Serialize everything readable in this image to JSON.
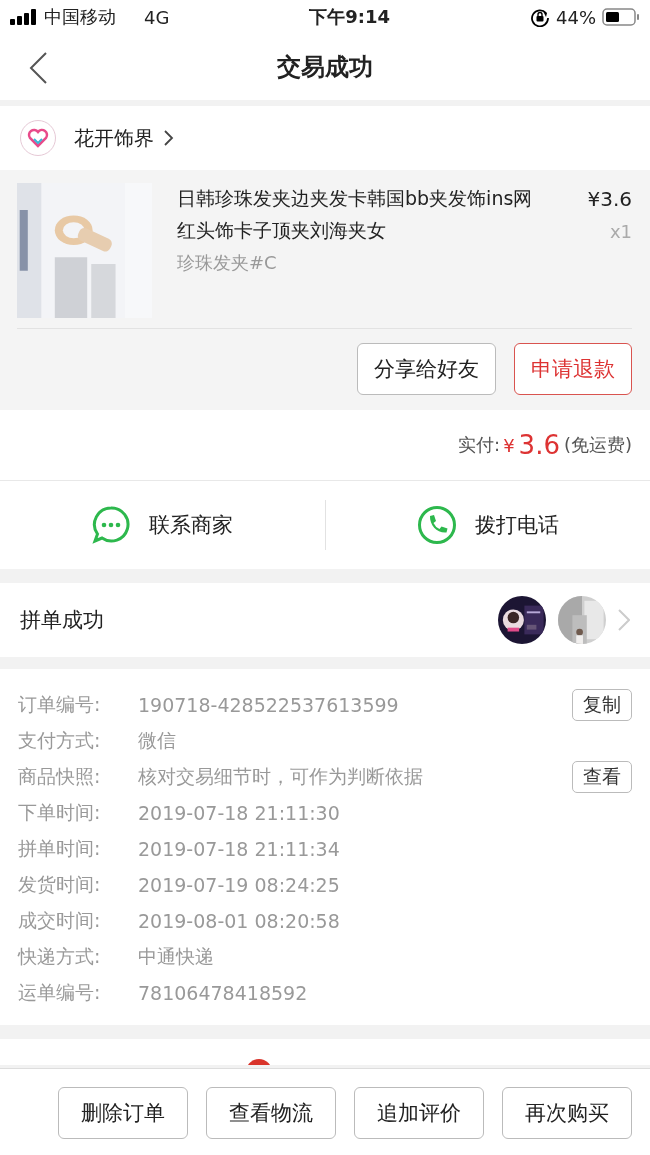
{
  "status_bar": {
    "carrier": "中国移动",
    "network": "4G",
    "time": "下午9:14",
    "battery": "44%"
  },
  "nav": {
    "title": "交易成功"
  },
  "shop": {
    "name": "花开饰界"
  },
  "product": {
    "title": "日韩珍珠发夹边夹发卡韩国bb夹发饰ins网红头饰卡子顶夹刘海夹女",
    "variant": "珍珠发夹#C",
    "price": "¥3.6",
    "quantity": "x1"
  },
  "product_actions": [
    {
      "label": "分享给好友",
      "kind": "plain"
    },
    {
      "label": "申请退款",
      "kind": "danger"
    }
  ],
  "payment": {
    "label": "实付:",
    "currency": "¥",
    "amount": "3.6",
    "note": "(免运费)"
  },
  "contact": [
    {
      "label": "联系商家",
      "kind": "chat"
    },
    {
      "label": "拨打电话",
      "kind": "phone"
    }
  ],
  "group_buy": {
    "title": "拼单成功"
  },
  "order_info": [
    {
      "label": "订单编号:",
      "value": "190718-428522537613599",
      "action": "复制"
    },
    {
      "label": "支付方式:",
      "value": "微信"
    },
    {
      "label": "商品快照:",
      "value": "核对交易细节时，可作为判断依据",
      "action": "查看"
    },
    {
      "label": "下单时间:",
      "value": "2019-07-18 21:11:30"
    },
    {
      "label": "拼单时间:",
      "value": "2019-07-18 21:11:34"
    },
    {
      "label": "发货时间:",
      "value": "2019-07-19 08:24:25"
    },
    {
      "label": "成交时间:",
      "value": "2019-08-01 08:20:58"
    },
    {
      "label": "快递方式:",
      "value": "中通快递"
    },
    {
      "label": "运单编号:",
      "value": "78106478418592"
    }
  ],
  "bottom_actions": [
    "删除订单",
    "查看物流",
    "追加评价",
    "再次购买"
  ]
}
